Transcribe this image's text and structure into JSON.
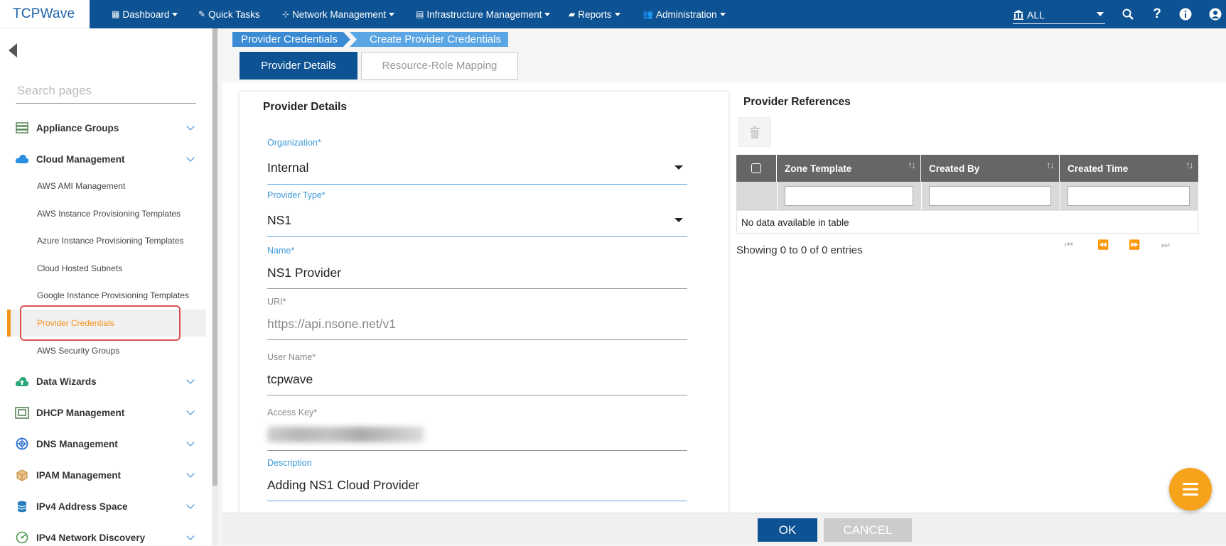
{
  "brand": "TCPWave",
  "nav": {
    "dashboard": "Dashboard",
    "quick_tasks": "Quick Tasks",
    "network_management": "Network Management",
    "infrastructure_management": "Infrastructure Management",
    "reports": "Reports",
    "administration": "Administration",
    "scope_selected": "ALL"
  },
  "sidebar": {
    "search_placeholder": "Search pages",
    "groups": [
      {
        "label": "Appliance Groups",
        "icon": "server-icon",
        "color": "#5a8a5a"
      },
      {
        "label": "Cloud Management",
        "icon": "cloud-icon",
        "color": "#2a8fe0"
      },
      {
        "label": "Data Wizards",
        "icon": "cloud-upload-icon",
        "color": "#2aa878"
      },
      {
        "label": "DHCP Management",
        "icon": "dhcp-icon",
        "color": "#4a7a4a"
      },
      {
        "label": "DNS Management",
        "icon": "globe-icon",
        "color": "#2a6fd0"
      },
      {
        "label": "IPAM Management",
        "icon": "cube-icon",
        "color": "#c08a3a"
      },
      {
        "label": "IPv4 Address Space",
        "icon": "database-icon",
        "color": "#2a7fc0"
      },
      {
        "label": "IPv4 Network Discovery",
        "icon": "radar-icon",
        "color": "#4a9a4a"
      }
    ],
    "cloud_items": [
      "AWS AMI Management",
      "AWS Instance Provisioning Templates",
      "Azure Instance Provisioning Templates",
      "Cloud Hosted Subnets",
      "Google Instance Provisioning Templates",
      "Provider Credentials",
      "AWS Security Groups"
    ]
  },
  "breadcrumb": [
    "Provider Credentials",
    "Create Provider Credentials"
  ],
  "tabs": {
    "active": "Provider Details",
    "inactive": "Resource-Role Mapping"
  },
  "form": {
    "title": "Provider Details",
    "organization_label": "Organization*",
    "organization_value": "Internal",
    "provider_type_label": "Provider Type*",
    "provider_type_value": "NS1",
    "name_label": "Name*",
    "name_value": "NS1 Provider",
    "uri_label": "URI*",
    "uri_value": "https://api.nsone.net/v1",
    "username_label": "User Name*",
    "username_value": "tcpwave",
    "access_key_label": "Access Key*",
    "description_label": "Description",
    "description_value": "Adding NS1 Cloud Provider"
  },
  "references": {
    "title": "Provider References",
    "columns": [
      "Zone Template",
      "Created By",
      "Created Time"
    ],
    "empty_text": "No data available in table",
    "showing": "Showing 0 to 0 of 0 entries"
  },
  "footer": {
    "ok": "OK",
    "cancel": "CANCEL"
  },
  "colors": {
    "primary": "#0d5293",
    "accent": "#f7941d",
    "highlight_border": "#d9534f"
  }
}
